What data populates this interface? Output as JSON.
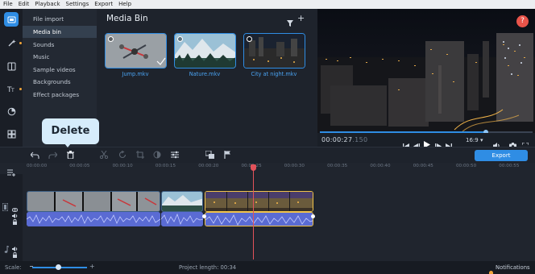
{
  "menu": [
    "File",
    "Edit",
    "Playback",
    "Settings",
    "Export",
    "Help"
  ],
  "sidebar": {
    "icons": [
      "import-icon",
      "magic-wand-icon",
      "transitions-icon",
      "titles-icon",
      "stickers-icon",
      "more-tools-icon"
    ]
  },
  "categories": [
    "File import",
    "Media bin",
    "Sounds",
    "Music",
    "Sample videos",
    "Backgrounds",
    "Effect packages"
  ],
  "bin": {
    "title": "Media Bin",
    "clips": [
      "Jump.mkv",
      "Nature.mkv",
      "City at night.mkv"
    ]
  },
  "player": {
    "time_main": "00:00:27",
    "time_frac": ".150",
    "aspect": "16:9",
    "progress": 0.78
  },
  "toolbar": {
    "export_label": "Export"
  },
  "tooltip": {
    "label": "Delete"
  },
  "ruler": [
    "00:00:00",
    "00:00:05",
    "00:00:10",
    "00:00:15",
    "00:00:20",
    "00:00:25",
    "00:00:30",
    "00:00:35",
    "00:00:40",
    "00:00:45",
    "00:00:50",
    "00:00:55"
  ],
  "status": {
    "scale_label": "Scale:",
    "project_length": "Project length:  00:34",
    "notifications": "Notifications"
  },
  "colors": {
    "accent": "#2f8de4",
    "playhead": "#e2525a",
    "audio": "#5d6fd6"
  }
}
